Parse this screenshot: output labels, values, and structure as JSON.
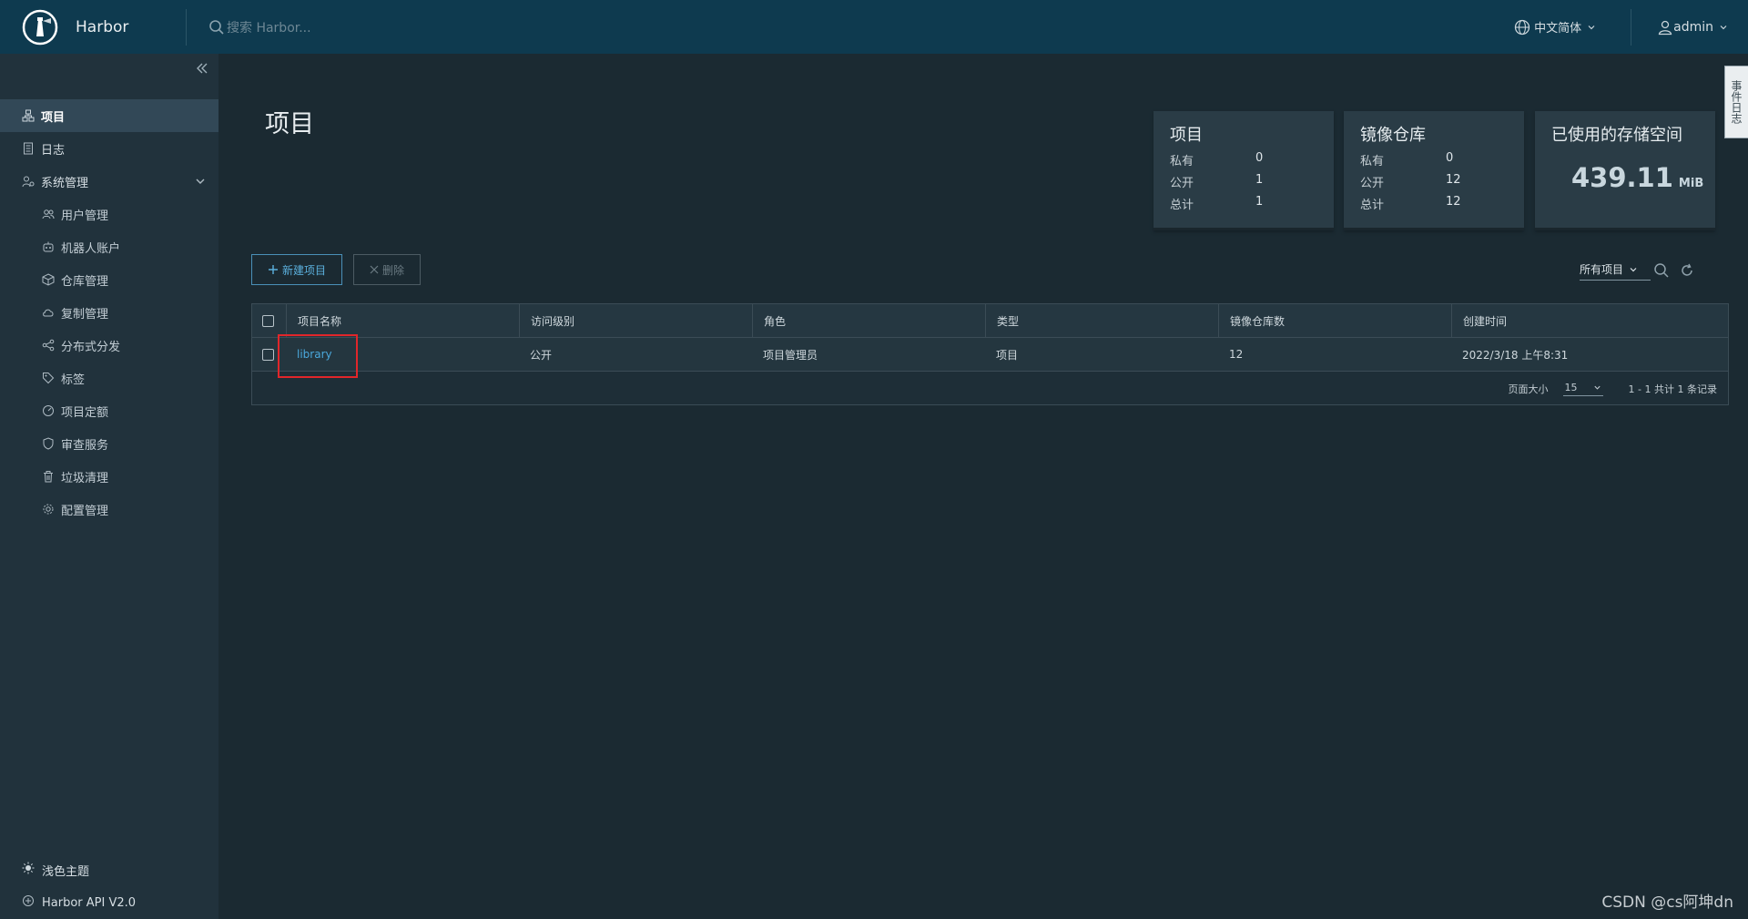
{
  "header": {
    "brand": "Harbor",
    "search_placeholder": "搜索 Harbor...",
    "language": "中文简体",
    "user": "admin"
  },
  "sidebar": {
    "items": [
      {
        "label": "项目",
        "icon": "projects-icon",
        "active": true
      },
      {
        "label": "日志",
        "icon": "log-icon"
      },
      {
        "label": "系统管理",
        "icon": "admin-icon"
      }
    ],
    "sub_items": [
      {
        "label": "用户管理",
        "icon": "users-icon"
      },
      {
        "label": "机器人账户",
        "icon": "robot-icon"
      },
      {
        "label": "仓库管理",
        "icon": "registry-icon"
      },
      {
        "label": "复制管理",
        "icon": "replication-icon"
      },
      {
        "label": "分布式分发",
        "icon": "distribution-icon"
      },
      {
        "label": "标签",
        "icon": "tag-icon"
      },
      {
        "label": "项目定额",
        "icon": "quota-icon"
      },
      {
        "label": "审查服务",
        "icon": "shield-icon"
      },
      {
        "label": "垃圾清理",
        "icon": "trash-icon"
      },
      {
        "label": "配置管理",
        "icon": "gear-icon"
      }
    ],
    "bottom": {
      "theme": "浅色主题",
      "api": "Harbor API V2.0"
    }
  },
  "page": {
    "title": "项目"
  },
  "cards": {
    "projects": {
      "title": "项目",
      "private_label": "私有",
      "private": "0",
      "public_label": "公开",
      "public": "1",
      "total_label": "总计",
      "total": "1"
    },
    "repos": {
      "title": "镜像仓库",
      "private_label": "私有",
      "private": "0",
      "public_label": "公开",
      "public": "12",
      "total_label": "总计",
      "total": "12"
    },
    "storage": {
      "title": "已使用的存储空间",
      "value": "439.11",
      "unit": "MiB"
    }
  },
  "toolbar": {
    "new_label": "新建项目",
    "delete_label": "删除",
    "filter": "所有项目"
  },
  "table": {
    "columns": [
      "项目名称",
      "访问级别",
      "角色",
      "类型",
      "镜像仓库数",
      "创建时间"
    ],
    "rows": [
      {
        "name": "library",
        "access": "公开",
        "role": "项目管理员",
        "type": "项目",
        "repos": "12",
        "created": "2022/3/18 上午8:31"
      }
    ],
    "page_size_label": "页面大小",
    "page_size": "15",
    "summary": "1 - 1 共计 1 条记录"
  },
  "event_tab": "事件日志",
  "watermark": "CSDN @cs阿坤dn",
  "colors": {
    "header": "#0e3a4f",
    "sidebar": "#21323c",
    "bg": "#1b2a32",
    "accent": "#4aa8dc",
    "highlight": "#e1262a"
  }
}
